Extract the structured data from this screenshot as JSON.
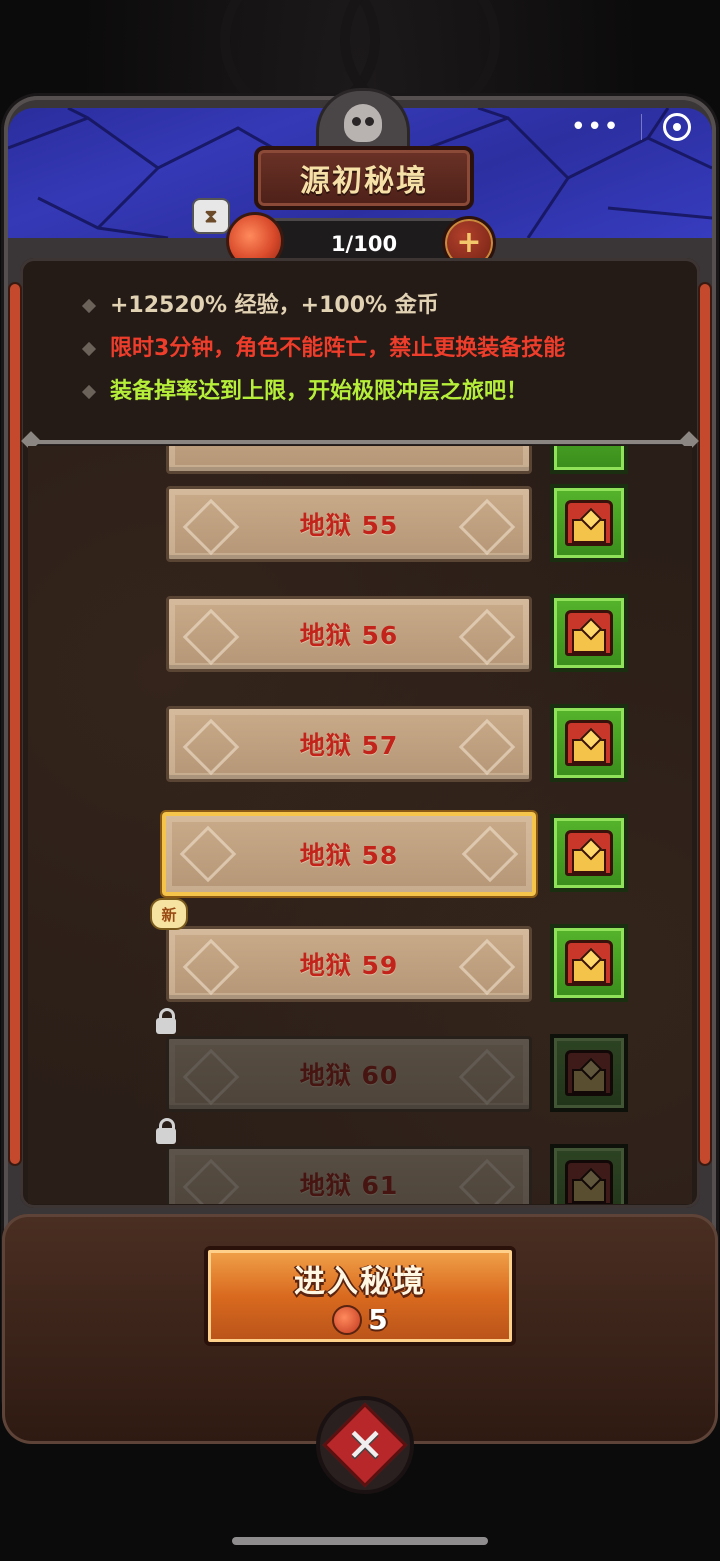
{
  "header": {
    "title": "源初秘境",
    "stamina": "1/100",
    "plus_label": "+",
    "hourglass_glyph": "⧗"
  },
  "capsule": {
    "more": "•••"
  },
  "description": {
    "lines": [
      "+12520% 经验，+100% 金币",
      "限时3分钟，角色不能阵亡，禁止更换装备技能",
      "装备掉率达到上限，开始极限冲层之旅吧！"
    ],
    "colors": [
      "#e2d2b4",
      "#ee3d2b",
      "#b6ef3a"
    ]
  },
  "levels": [
    {
      "label": "地狱 55",
      "locked": false,
      "selected": false,
      "new": false
    },
    {
      "label": "地狱 56",
      "locked": false,
      "selected": false,
      "new": false
    },
    {
      "label": "地狱 57",
      "locked": false,
      "selected": false,
      "new": false
    },
    {
      "label": "地狱 58",
      "locked": false,
      "selected": true,
      "new": false
    },
    {
      "label": "地狱 59",
      "locked": false,
      "selected": false,
      "new": true
    },
    {
      "label": "地狱 60",
      "locked": true,
      "selected": false,
      "new": false
    },
    {
      "label": "地狱 61",
      "locked": true,
      "selected": false,
      "new": false
    }
  ],
  "new_badge": "新",
  "enter_button": {
    "label": "进入秘境",
    "cost": "5"
  },
  "close_button": {
    "glyph": "✕"
  },
  "colors": {
    "banner_blue": "#3539b6",
    "chest_green": "#55b42b",
    "level_text_red": "#c2241b",
    "selected_gold": "#f4c54a",
    "button_orange": "#d96a1f"
  }
}
